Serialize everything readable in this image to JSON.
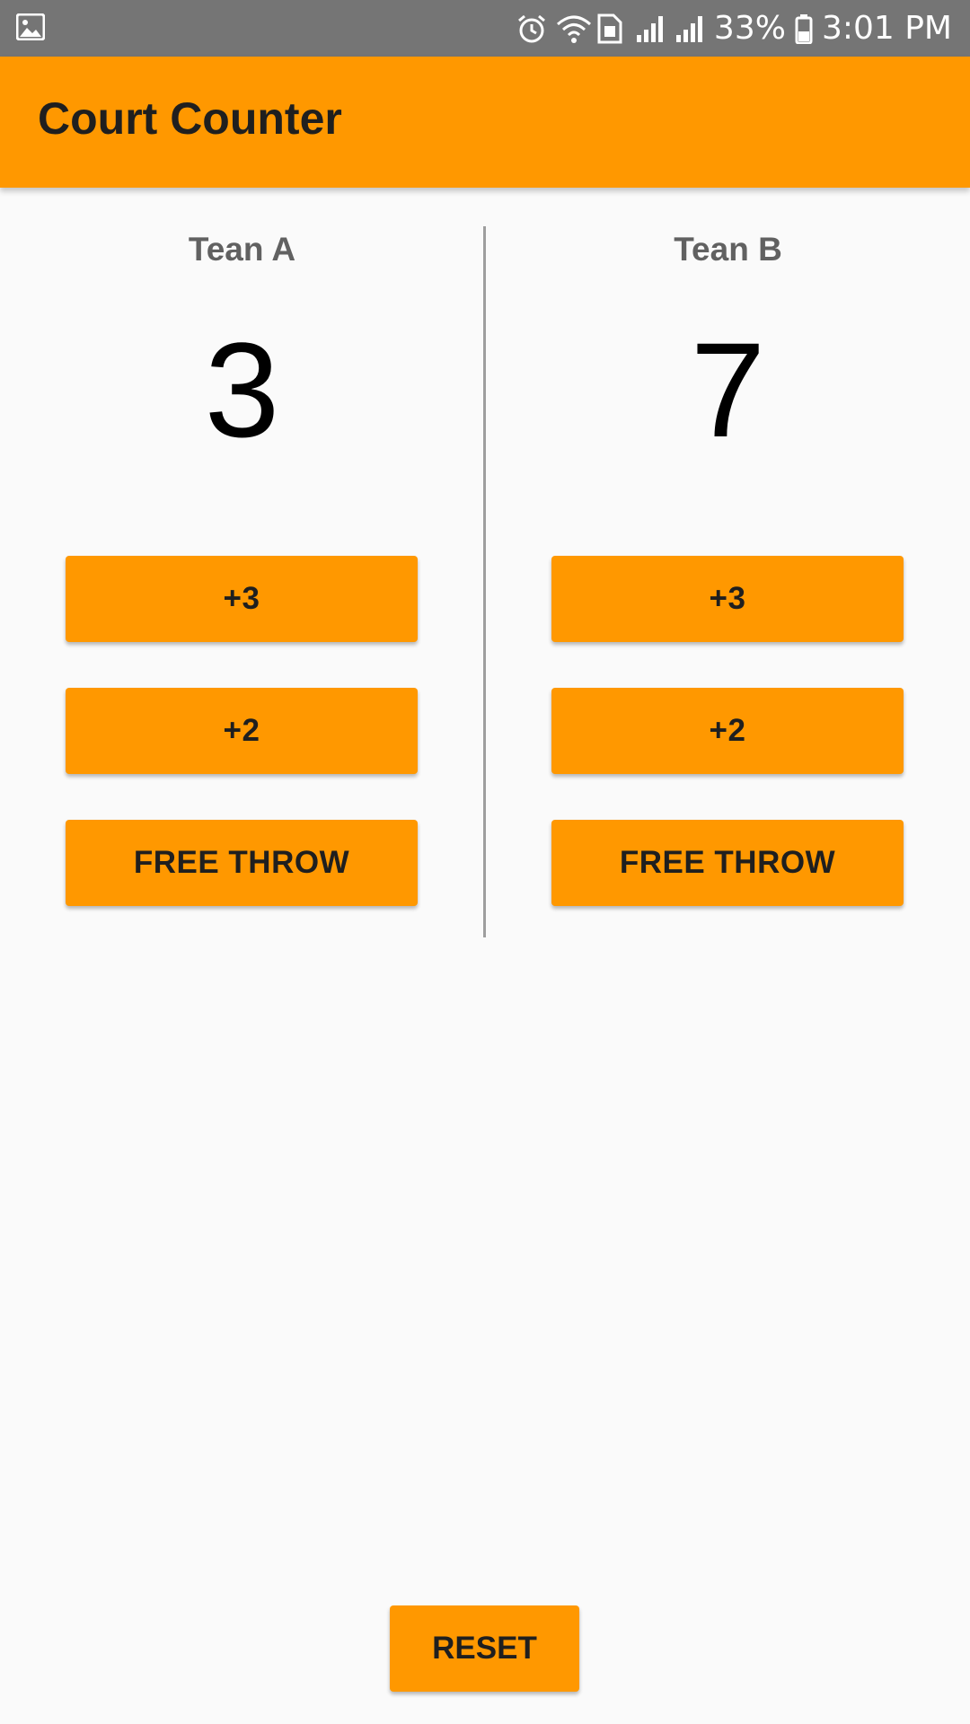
{
  "status_bar": {
    "icons": [
      "gallery-icon",
      "alarm-icon",
      "wifi-icon",
      "sim-icon",
      "signal-icon",
      "signal-icon",
      "battery-icon"
    ],
    "battery": "33%",
    "time": "3:01 PM"
  },
  "app_bar": {
    "title": "Court Counter",
    "color": "#ff9800"
  },
  "teams": [
    {
      "name": "Tean A",
      "score": "3",
      "buttons": [
        "+3",
        "+2",
        "FREE THROW"
      ]
    },
    {
      "name": "Tean B",
      "score": "7",
      "buttons": [
        "+3",
        "+2",
        "FREE THROW"
      ]
    }
  ],
  "reset_label": "RESET"
}
